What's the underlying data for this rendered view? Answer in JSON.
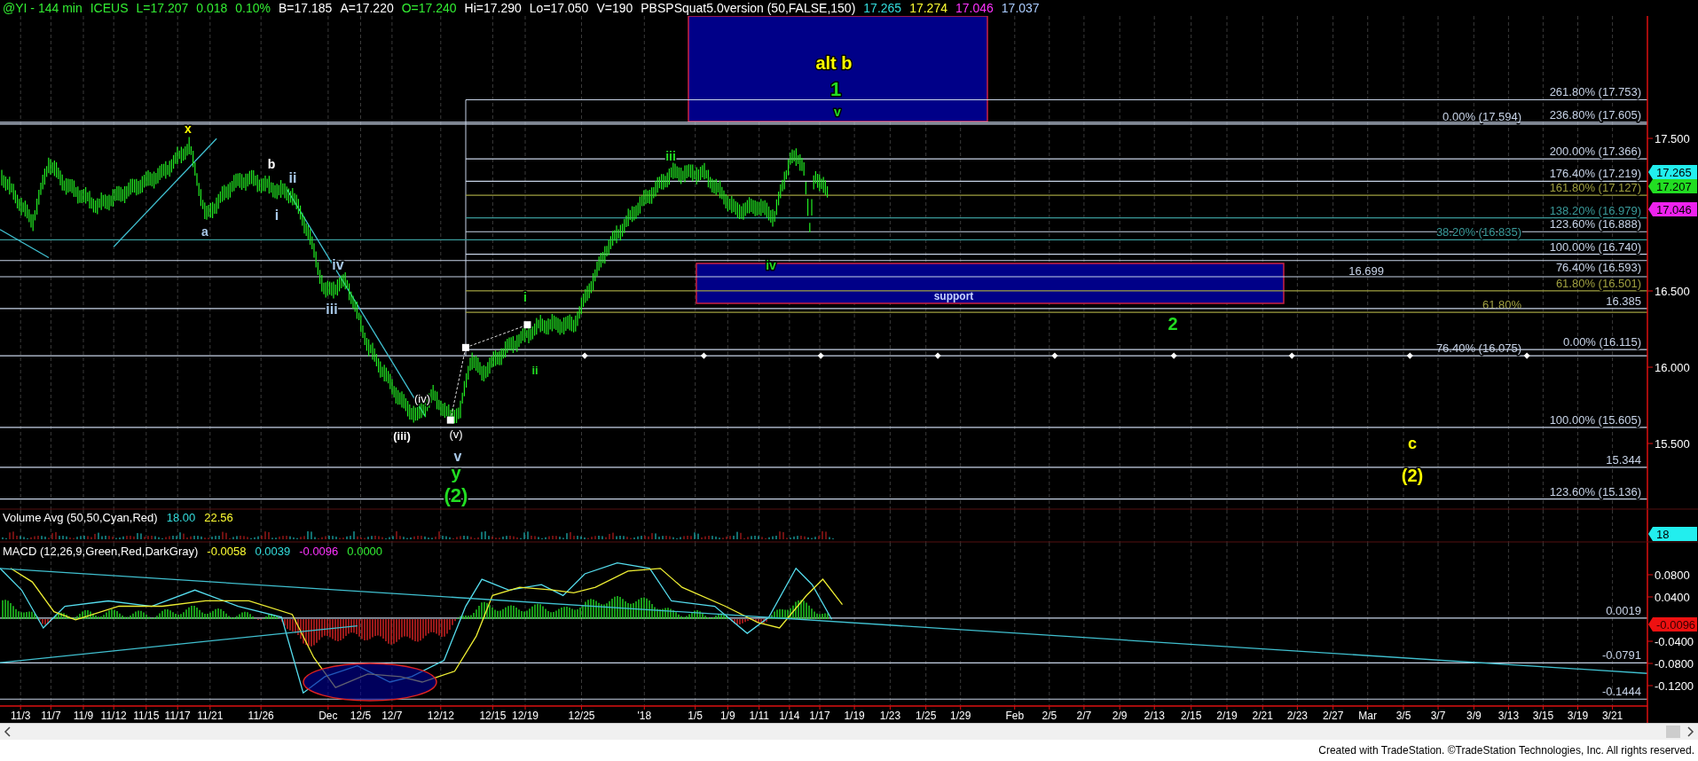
{
  "header": {
    "readouts": [
      {
        "text": "@YI - 144 min",
        "color": "#33ee33"
      },
      {
        "text": "ICEUS",
        "color": "#33ee33"
      },
      {
        "text": "L=17.207",
        "color": "#33ee33"
      },
      {
        "text": "0.018",
        "color": "#33ee33"
      },
      {
        "text": "0.10%",
        "color": "#33ee33"
      },
      {
        "text": "B=17.185",
        "color": "#ffffff"
      },
      {
        "text": "A=17.220",
        "color": "#ffffff"
      },
      {
        "text": "O=17.240",
        "color": "#33ee33"
      },
      {
        "text": "Hi=17.290",
        "color": "#ffffff"
      },
      {
        "text": "Lo=17.050",
        "color": "#ffffff"
      },
      {
        "text": "V=190",
        "color": "#ffffff"
      },
      {
        "text": "PBSPSquat5.0version (50,FALSE,150)",
        "color": "#ffffff"
      },
      {
        "text": "17.265",
        "color": "#33dddd"
      },
      {
        "text": "17.274",
        "color": "#ffff33"
      },
      {
        "text": "17.046",
        "color": "#ff33ff"
      },
      {
        "text": "17.037",
        "color": "#aaccff"
      }
    ]
  },
  "price_panel": {
    "wave_labels": [
      {
        "text": "x",
        "color": "#ffff00"
      },
      {
        "text": "a",
        "color": "#a8c8e8"
      },
      {
        "text": "b",
        "color": "#ffffff"
      },
      {
        "text": "ii",
        "color": "#a8c8e8"
      },
      {
        "text": "i",
        "color": "#a8c8e8"
      },
      {
        "text": "iv",
        "color": "#a8c8e8"
      },
      {
        "text": "iii",
        "color": "#a8c8e8"
      },
      {
        "text": "(iv)",
        "color": "#ffffff"
      },
      {
        "text": "(iii)",
        "color": "#ffffff"
      },
      {
        "text": "(v)",
        "color": "#ffffff"
      },
      {
        "text": "v",
        "color": "#a8c8e8"
      },
      {
        "text": "y",
        "color": "#22dd22"
      },
      {
        "text": "(2)",
        "color": "#22dd22"
      },
      {
        "text": "i",
        "color": "#22dd22"
      },
      {
        "text": "ii",
        "color": "#22dd22"
      },
      {
        "text": "iii",
        "color": "#22dd22"
      },
      {
        "text": "iv",
        "color": "#22dd22"
      },
      {
        "text": "alt b",
        "color": "#ffff00"
      },
      {
        "text": "1",
        "color": "#22dd22"
      },
      {
        "text": "v",
        "color": "#22dd22"
      },
      {
        "text": "2",
        "color": "#22dd22"
      },
      {
        "text": "c",
        "color": "#ffff00"
      },
      {
        "text": "(2)",
        "color": "#ffff00"
      }
    ],
    "fib_levels": [
      {
        "label": "261.80% (17.753)",
        "color": "#c8d4e8"
      },
      {
        "label": "0.00% (17.594)",
        "color": "#c8d4e8"
      },
      {
        "label": "236.80% (17.605)",
        "color": "#c8d4e8"
      },
      {
        "label": "200.00% (17.366)",
        "color": "#c8d4e8"
      },
      {
        "label": "176.40% (17.219)",
        "color": "#c8d4e8"
      },
      {
        "label": "161.80% (17.127)",
        "color": "#a0a040"
      },
      {
        "label": "138.20% (16.979)",
        "color": "#3a9a9a"
      },
      {
        "label": "123.60% (16.888)",
        "color": "#c8d4e8"
      },
      {
        "label": "38.20% (16.835)",
        "color": "#3a9a9a"
      },
      {
        "label": "16.699",
        "color": "#c8d4e8"
      },
      {
        "label": "100.00% (16.740)",
        "color": "#c8d4e8"
      },
      {
        "label": "76.40% (16.593)",
        "color": "#c8d4e8"
      },
      {
        "label": "61.80% (16.501)",
        "color": "#a0a040"
      },
      {
        "label": "61.80%",
        "color": "#a0a040"
      },
      {
        "label": "16.385",
        "color": "#c8d4e8"
      },
      {
        "label": "76.40% (16.075)",
        "color": "#c8d4e8"
      },
      {
        "label": "0.00% (16.115)",
        "color": "#c8d4e8"
      },
      {
        "label": "100.00% (15.605)",
        "color": "#c8d4e8"
      },
      {
        "label": "15.344",
        "color": "#c8d4e8"
      },
      {
        "label": "123.60% (15.136)",
        "color": "#c8d4e8"
      }
    ],
    "support_box": {
      "label": "support"
    },
    "price_ticks": [
      "17.500",
      "16.500",
      "16.000",
      "15.500"
    ],
    "price_badges": [
      {
        "text": "17.265",
        "color": "#22eeee"
      },
      {
        "text": "17.207",
        "color": "#22dd22"
      },
      {
        "text": "17.046",
        "color": "#ee22ee"
      }
    ]
  },
  "volume_panel": {
    "title": "Volume Avg (50,50,Cyan,Red)",
    "readouts": [
      {
        "text": "18.00",
        "color": "#33dddd"
      },
      {
        "text": "22.56",
        "color": "#ffff33"
      }
    ],
    "badge": "18"
  },
  "macd_panel": {
    "title": "MACD (12,26,9,Green,Red,DarkGray)",
    "readouts": [
      {
        "text": "-0.0058",
        "color": "#ffff33"
      },
      {
        "text": "0.0039",
        "color": "#33dddd"
      },
      {
        "text": "-0.0096",
        "color": "#ff33ff"
      },
      {
        "text": "0.0000",
        "color": "#33ee33"
      }
    ],
    "levels": [
      "0.0019",
      "-0.0791",
      "-0.1444"
    ],
    "ticks": [
      "0.0800",
      "0.0400",
      "-0.0400",
      "-0.0800",
      "-0.1200"
    ],
    "badge": "-0.0096"
  },
  "date_axis": [
    "11/3",
    "11/7",
    "11/9",
    "11/12",
    "11/15",
    "11/17",
    "11/21",
    "11/26",
    "Dec",
    "12/5",
    "12/7",
    "12/12",
    "12/15",
    "12/19",
    "12/25",
    "'18",
    "1/5",
    "1/9",
    "1/11",
    "1/14",
    "1/17",
    "1/19",
    "1/23",
    "1/25",
    "1/29",
    "Feb",
    "2/5",
    "2/7",
    "2/9",
    "2/13",
    "2/15",
    "2/19",
    "2/21",
    "2/23",
    "2/27",
    "Mar",
    "3/5",
    "3/7",
    "3/9",
    "3/13",
    "3/15",
    "3/19",
    "3/21"
  ],
  "footer": "Created with TradeStation. ©TradeStation Technologies, Inc. All rights reserved."
}
